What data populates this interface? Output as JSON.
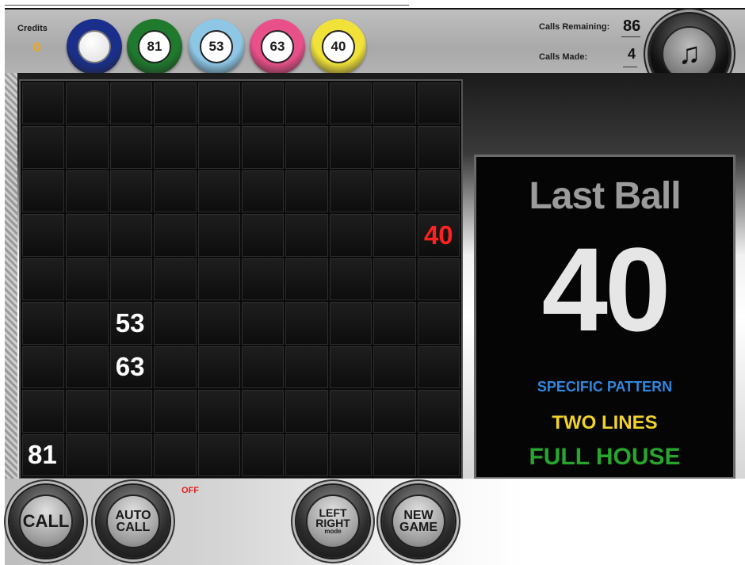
{
  "header": {
    "credits_label": "Credits",
    "credits_value": "0",
    "recent_balls": [
      {
        "number": "",
        "ring_color": "#1a2f8c"
      },
      {
        "number": "81",
        "ring_color": "#1f7a2e"
      },
      {
        "number": "53",
        "ring_color": "#8ec7e6"
      },
      {
        "number": "63",
        "ring_color": "#e8508a"
      },
      {
        "number": "40",
        "ring_color": "#f1e23a"
      }
    ],
    "calls_remaining_label": "Calls Remaining:",
    "calls_remaining_value": "86",
    "calls_made_label": "Calls Made:",
    "calls_made_value": "4",
    "music_icon": "music-note-icon"
  },
  "board": {
    "columns": 10,
    "rows": 9,
    "called": [
      {
        "row": 3,
        "col": 9,
        "number": "40",
        "is_last": true
      },
      {
        "row": 5,
        "col": 2,
        "number": "53",
        "is_last": false
      },
      {
        "row": 6,
        "col": 2,
        "number": "63",
        "is_last": false
      },
      {
        "row": 8,
        "col": 0,
        "number": "81",
        "is_last": false
      }
    ],
    "last_color": "#ff2020"
  },
  "last_ball": {
    "title": "Last Ball",
    "number": "40",
    "patterns": {
      "specific": "SPECIFIC PATTERN",
      "two_lines": "TWO LINES",
      "full_house": "FULL HOUSE"
    }
  },
  "controls": {
    "call_label": "CALL",
    "auto_call_line1": "AUTO",
    "auto_call_line2": "CALL",
    "auto_call_status": "OFF",
    "left_right_line1": "LEFT",
    "left_right_line2": "RIGHT",
    "left_right_line3": "mode",
    "new_game_line1": "NEW",
    "new_game_line2": "GAME"
  }
}
